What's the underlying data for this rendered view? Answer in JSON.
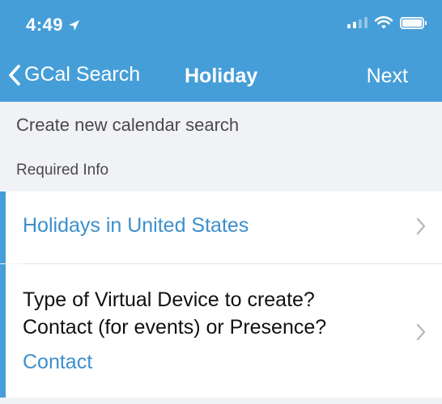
{
  "status_bar": {
    "time": "4:49",
    "location_icon": "location-arrow-icon",
    "signal_icon": "cellular-signal-icon",
    "wifi_icon": "wifi-icon",
    "battery_icon": "battery-icon"
  },
  "nav": {
    "back_label": "GCal Search",
    "title": "Holiday",
    "next_label": "Next",
    "back_icon": "chevron-left-icon"
  },
  "page": {
    "subtitle": "Create new calendar search",
    "section_header": "Required Info"
  },
  "rows": [
    {
      "value": "Holidays in United States",
      "icon": "chevron-right-icon"
    },
    {
      "question_line_1": "Type of Virtual Device to create?",
      "question_line_2": "Contact (for events) or Presence?",
      "value": "Contact",
      "icon": "chevron-right-icon"
    }
  ],
  "colors": {
    "header": "#469ed8",
    "accent": "#469ed8",
    "link": "#3d8fcc",
    "background": "#f1f2f6"
  }
}
